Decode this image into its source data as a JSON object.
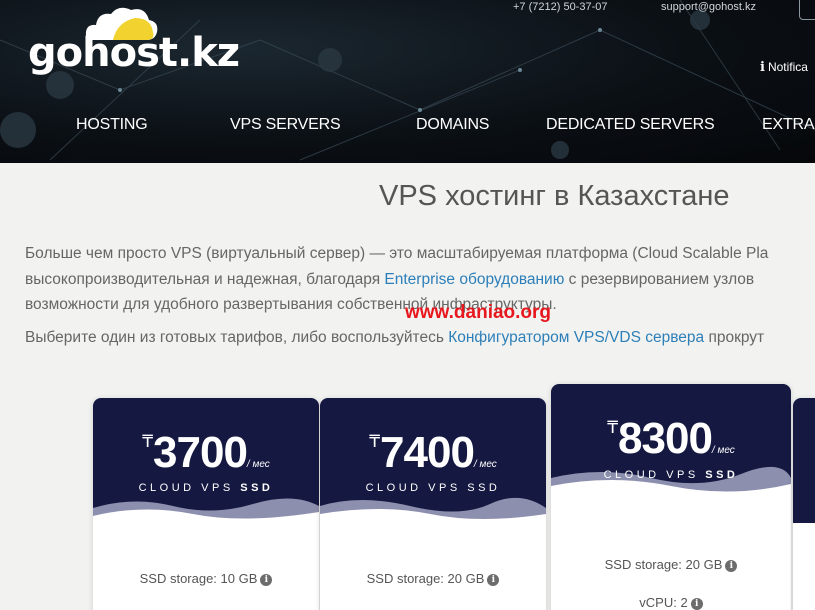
{
  "header": {
    "logo": "gohost.kz",
    "phone": "+7 (7212) 50-37-07",
    "email": "support@gohost.kz",
    "notifications": "Notifica",
    "nav": [
      "HOSTING",
      "VPS SERVERS",
      "DOMAINS",
      "DEDICATED SERVERS",
      "EXTRA"
    ]
  },
  "main": {
    "title": "VPS хостинг в Казахстане",
    "para1_line1": "Больше чем просто VPS (виртуальный сервер) — это масштабируемая платформа (Cloud Scalable Pla",
    "para1_line2_pre": "высокопроизводительная и надежная, благодаря ",
    "para1_line2_link": "Enterprise оборудованию",
    "para1_line2_post": " с резервированием узлов",
    "para1_line3": "возможности для удобного развертывания собственной инфраструктуры.",
    "para2_pre": "Выберите один из готовых тарифов, либо воспользуйтесь ",
    "para2_link": "Конфигуратором VPS/VDS сервера",
    "para2_post": " прокрут",
    "watermark": "www.daniao.org"
  },
  "plans": [
    {
      "currency": "₸",
      "price": "3700",
      "per": "/ мес",
      "name_pre": "CLOUD VPS ",
      "name_bold": "SSD",
      "specs": [
        "SSD storage: 10 GB"
      ]
    },
    {
      "currency": "₸",
      "price": "7400",
      "per": "/ мес",
      "name_pre": "CLOUD VPS ",
      "name_bold": "SSD",
      "specs": [
        "SSD storage: 20 GB"
      ]
    },
    {
      "currency": "₸",
      "price": "8300",
      "per": "/ мес",
      "name_pre": "CLOUD VPS ",
      "name_bold": "SSD",
      "specs": [
        "SSD storage: 20 GB",
        "vCPU: 2"
      ]
    }
  ],
  "colors": {
    "card_header": "#151840",
    "link": "#2c7fb8",
    "watermark": "#e8171e"
  },
  "icons": {
    "info": "info-circle-icon",
    "notification": "info-icon"
  }
}
